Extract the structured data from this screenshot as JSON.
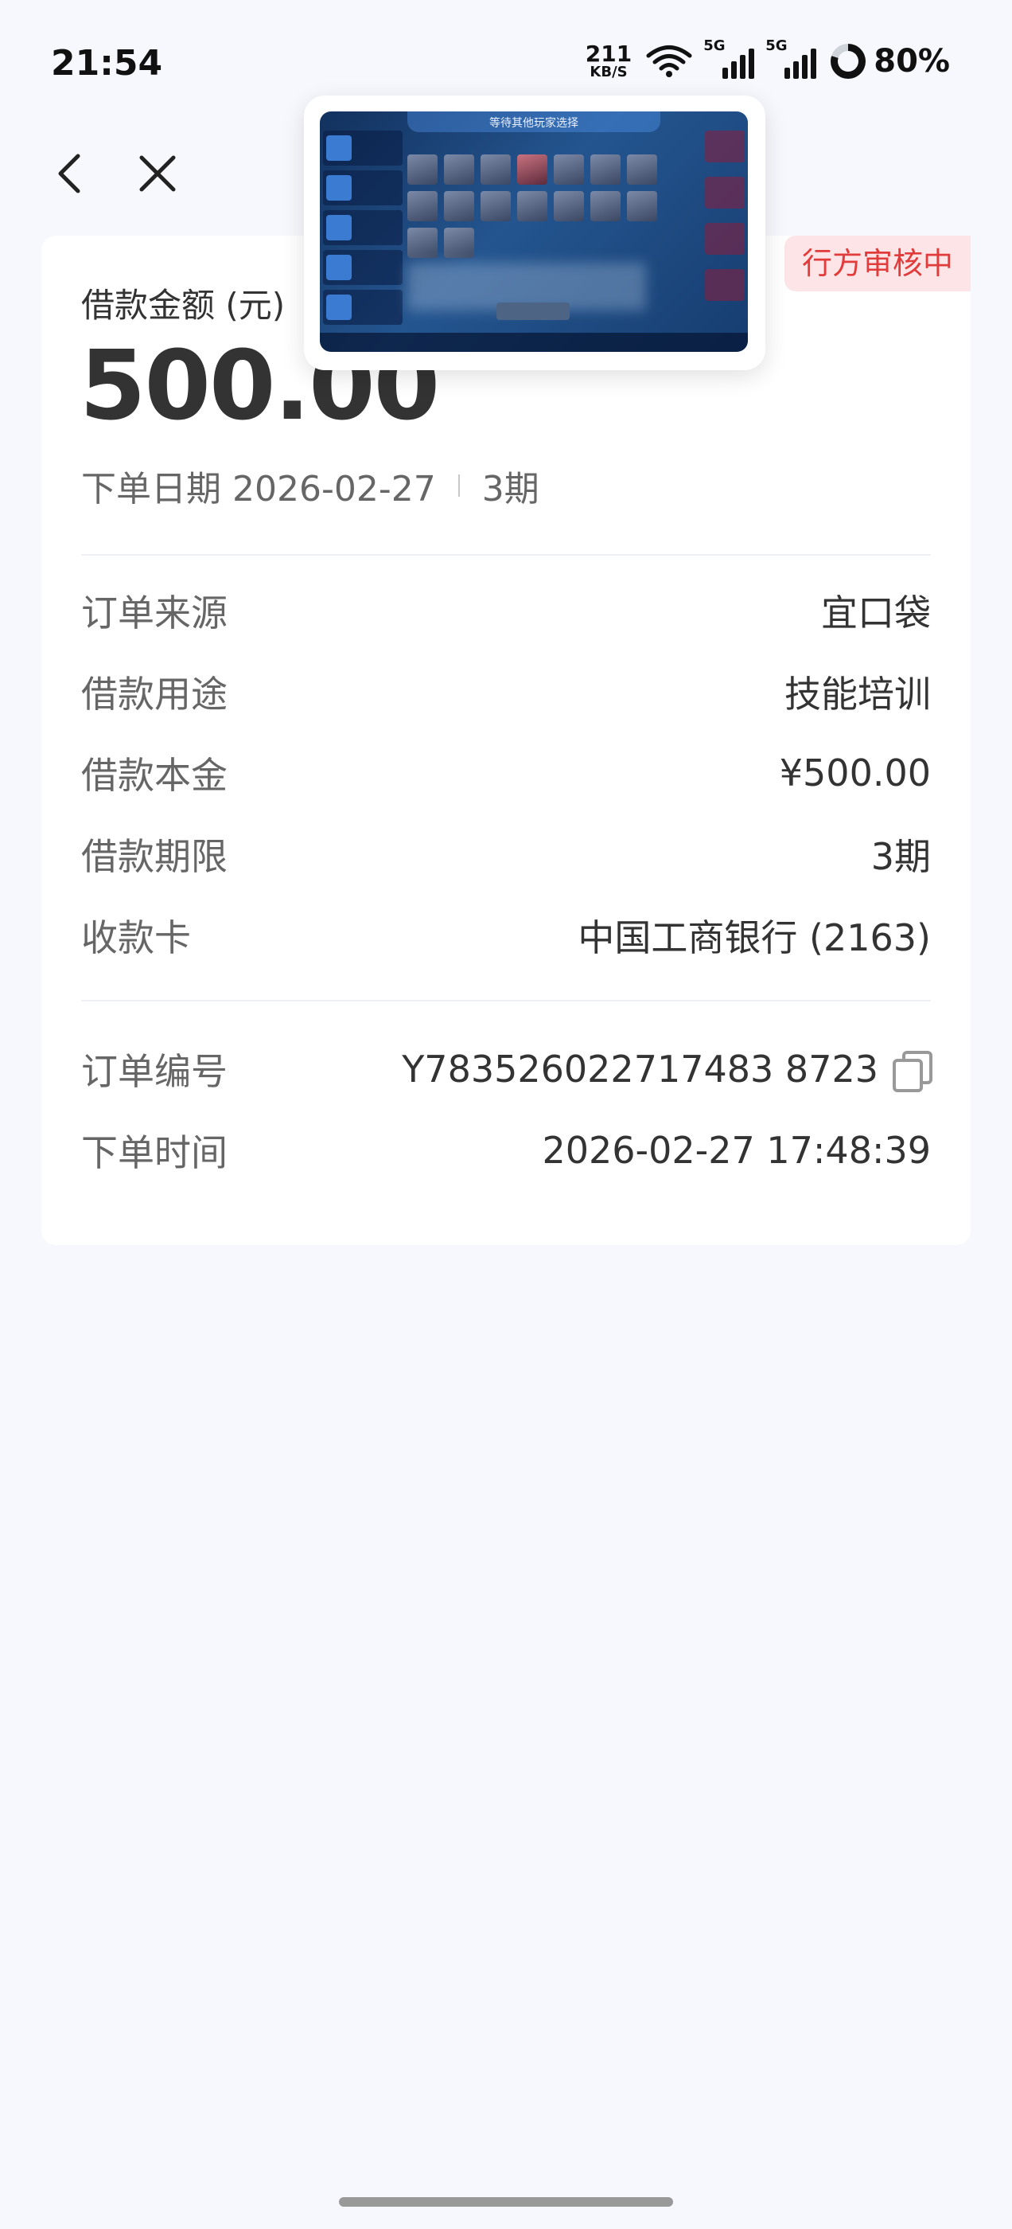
{
  "status_bar": {
    "time": "21:54",
    "net_speed_value": "211",
    "net_speed_unit": "KB/S",
    "signal_tag_1": "5G",
    "signal_tag_2": "5G",
    "battery_percent": "80%",
    "battery_level": 0.8,
    "icons": [
      "wifi-icon",
      "signal-5g-icon",
      "signal-5g-icon",
      "battery-ring-icon"
    ]
  },
  "nav": {
    "back_icon": "chevron-left-icon",
    "close_icon": "close-icon"
  },
  "order": {
    "status": "行方审核中",
    "amount_label": "借款金额 (元)",
    "amount": "500.00",
    "order_date_text": "下单日期 2026-02-27",
    "term_summary": "3期",
    "details": [
      {
        "label": "订单来源",
        "value": "宜口袋"
      },
      {
        "label": "借款用途",
        "value": "技能培训"
      },
      {
        "label": "借款本金",
        "value": "¥500.00"
      },
      {
        "label": "借款期限",
        "value": "3期"
      },
      {
        "label": "收款卡",
        "value": "中国工商银行 (2163)"
      }
    ],
    "order_number_label": "订单编号",
    "order_number": "Y783526022717483 8723",
    "order_time_label": "下单时间",
    "order_time": "2026-02-27 17:48:39"
  },
  "pip": {
    "title": "等待其他玩家选择"
  },
  "colors": {
    "background": "#f6f8fd",
    "badge_bg": "#fde5e7",
    "badge_text": "#e23b3b"
  }
}
